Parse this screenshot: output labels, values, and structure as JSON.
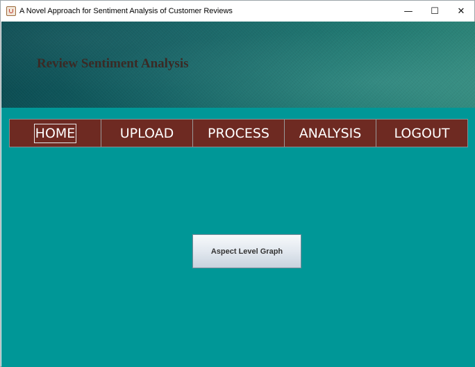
{
  "window": {
    "title": "A Novel Approach for Sentiment Analysis of Customer Reviews",
    "icon": "java-cup-icon",
    "controls": {
      "minimize": "—",
      "maximize": "☐",
      "close": "✕"
    }
  },
  "banner": {
    "title": "Review Sentiment Analysis"
  },
  "nav": {
    "items": [
      {
        "label": "HOME",
        "active": true
      },
      {
        "label": "UPLOAD",
        "active": false
      },
      {
        "label": "PROCESS",
        "active": false
      },
      {
        "label": "ANALYSIS",
        "active": false
      },
      {
        "label": "LOGOUT",
        "active": false
      }
    ]
  },
  "main": {
    "button_label": "Aspect Level Graph"
  },
  "colors": {
    "background": "#009797",
    "nav_bar": "#6e2a22",
    "banner_dark": "#0b4c52",
    "banner_light": "#2e8579"
  }
}
